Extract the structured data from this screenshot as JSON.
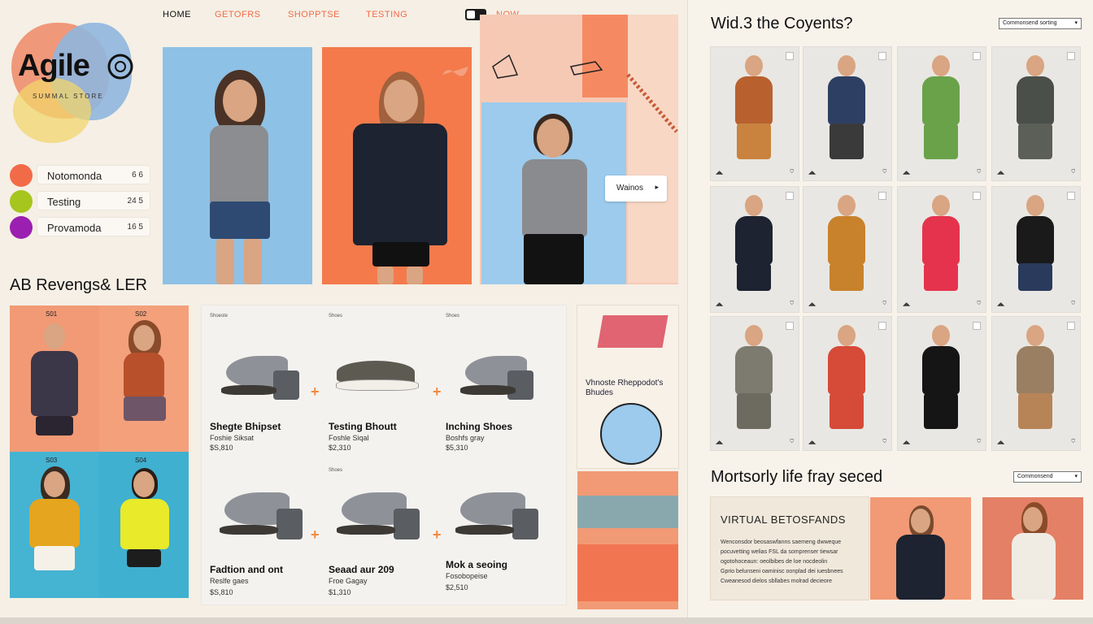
{
  "nav": {
    "home": "HOME",
    "items": [
      "GETOFRS",
      "SHOPPTSE",
      "TESTING"
    ],
    "now": "NOW"
  },
  "logo": {
    "text": "Agile",
    "sub": "SUMMAL STORE"
  },
  "legend": [
    {
      "label": "Notomonda",
      "value": "6 6",
      "color": "#f26b48"
    },
    {
      "label": "Testing",
      "value": "24 5",
      "color": "#a6c51d"
    },
    {
      "label": "Provamoda",
      "value": "16 5",
      "color": "#9b1fb0"
    }
  ],
  "hero": {
    "button": "Wainos"
  },
  "section_left": {
    "title": "AB Revengs& LER"
  },
  "models_grid": {
    "labels": [
      "S01",
      "S02",
      "S03",
      "S04"
    ]
  },
  "shoes": [
    {
      "title": "Shegte Bhipset",
      "sub": "Foshie Siksat",
      "price": "$S,810"
    },
    {
      "title": "Testing Bhoutt",
      "sub": "Foshle Siqal",
      "price": "$2,310"
    },
    {
      "title": "Inching Shoes",
      "sub": "Boshfs gray",
      "price": "$5,310"
    },
    {
      "title": "Fadtion and ont",
      "sub": "Reslfe gaes",
      "price": "$S,810"
    },
    {
      "title": "Seaad aur 209",
      "sub": "Froe Gagay",
      "price": "$1,310"
    },
    {
      "title": "Mok a seoing",
      "sub": "Fosobopeise",
      "price": "$2,510"
    }
  ],
  "shoe_group_labels": [
    "Shoeste",
    "Shoes",
    "Shoes",
    "Shoes"
  ],
  "art_card": {
    "text": "Vhnoste Rheppodot's Bhudes"
  },
  "right": {
    "title": "Wid.3 the Coyents?",
    "select": "Commonsend sorting",
    "section2_title": "Mortsorly life fray seced",
    "select2": "Commonsend",
    "feature_title": "VIRTUAL BETOSFANDS",
    "feature_lines": [
      "Wenconsdor beosaswfanns saemeng dwweque",
      "pocuvetting welias FSL da somprenser tiewsar",
      "ogotohoceaun: oeolbibes de loe nocdeolin",
      "Gprio belunseni oaminisc oonplad dei iuesbnees",
      "Cweanesod dielos sbllabes molrad decieore"
    ]
  },
  "colors": {
    "accent": "#f26b48",
    "blue_panel": "#8ec1e6",
    "orange_panel": "#f47a4c",
    "teal_panel": "#45b3d2",
    "salmon_panel": "#f19a75"
  }
}
